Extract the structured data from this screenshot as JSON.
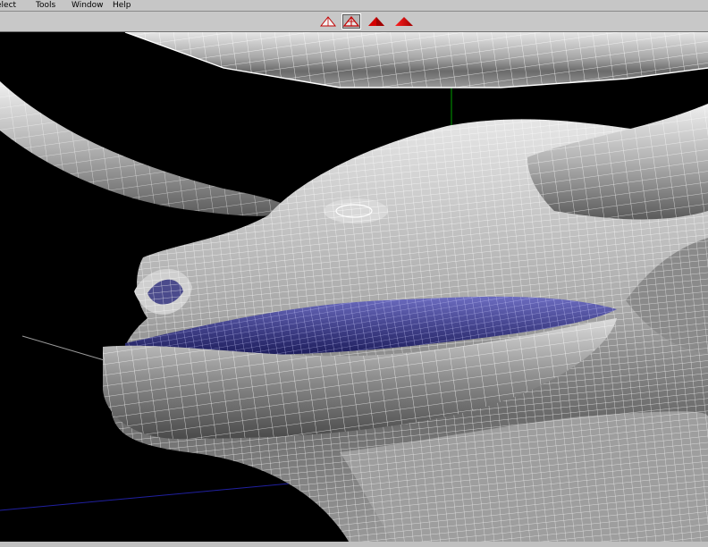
{
  "menubar": {
    "items": [
      {
        "label": "elect"
      },
      {
        "label": "Tools"
      },
      {
        "label": "Window"
      },
      {
        "label": "Help"
      }
    ]
  },
  "toolbar": {
    "shading_buttons": [
      {
        "icon": "wireframe-shade-icon",
        "selected": false
      },
      {
        "icon": "wireframe-on-shaded-icon",
        "selected": true
      },
      {
        "icon": "shaded-icon",
        "selected": false
      },
      {
        "icon": "smooth-shaded-icon",
        "selected": false
      }
    ]
  },
  "viewport": {
    "background": "#000000",
    "axis_colors": {
      "y": "#00a000",
      "x": "#c00000",
      "z": "#2020a0",
      "grid": "#9a9a9a"
    },
    "mesh_color": "#bdbdbd",
    "wire_color": "#ffffff",
    "mouth_color": "#3a3a9a"
  }
}
